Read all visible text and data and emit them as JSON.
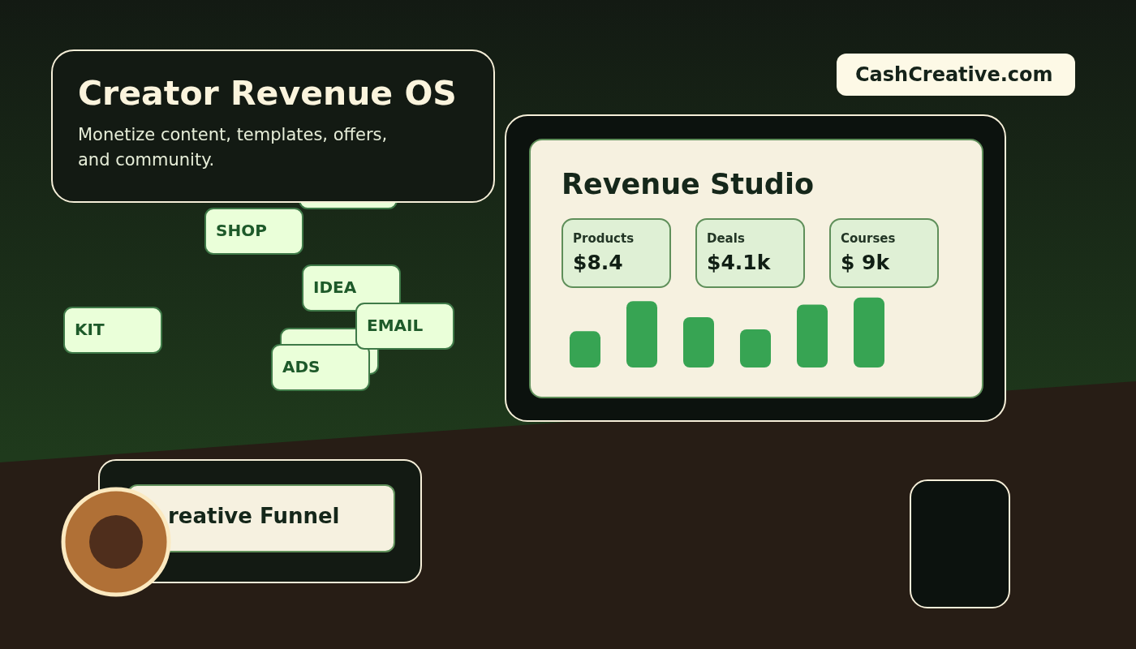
{
  "header": {
    "title": "Creator Revenue OS",
    "subtitle": "Monetize content, templates, offers, and community."
  },
  "tags": [
    {
      "label": "SHOP"
    },
    {
      "label": "IDEA"
    },
    {
      "label": "KIT"
    },
    {
      "label": "ADS"
    },
    {
      "label": "EMAIL"
    }
  ],
  "brand": {
    "label": "CashCreative.com"
  },
  "studio": {
    "title": "Revenue Studio",
    "metrics": [
      {
        "label": "Products",
        "value": "$8.4"
      },
      {
        "label": "Deals",
        "value": "$4.1k"
      },
      {
        "label": "Courses",
        "value": "$ 9k"
      }
    ]
  },
  "funnel": {
    "label": "reative Funnel"
  }
}
